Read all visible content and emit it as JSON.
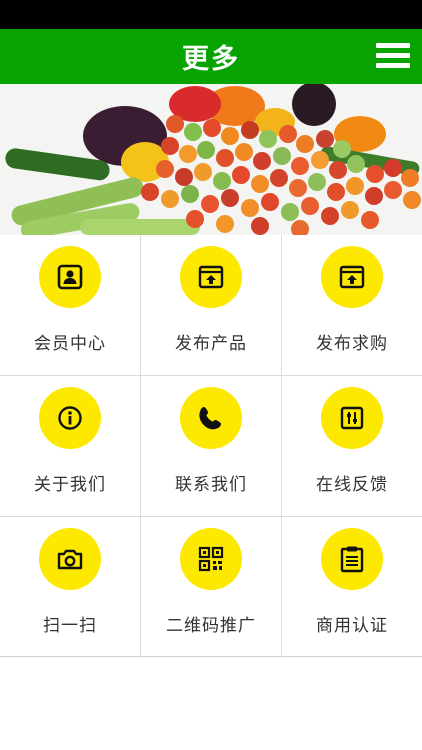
{
  "header": {
    "title": "更多"
  },
  "menu": {
    "items": [
      {
        "label": "会员中心",
        "icon": "member-card-icon"
      },
      {
        "label": "发布产品",
        "icon": "publish-product-icon"
      },
      {
        "label": "发布求购",
        "icon": "publish-request-icon"
      },
      {
        "label": "关于我们",
        "icon": "info-icon"
      },
      {
        "label": "联系我们",
        "icon": "phone-icon"
      },
      {
        "label": "在线反馈",
        "icon": "feedback-icon"
      },
      {
        "label": "扫一扫",
        "icon": "camera-icon"
      },
      {
        "label": "二维码推广",
        "icon": "qr-code-icon"
      },
      {
        "label": "商用认证",
        "icon": "clipboard-icon"
      }
    ]
  },
  "colors": {
    "header_bg": "#07a300",
    "icon_bg": "#fde800",
    "status_bar": "#000000"
  }
}
